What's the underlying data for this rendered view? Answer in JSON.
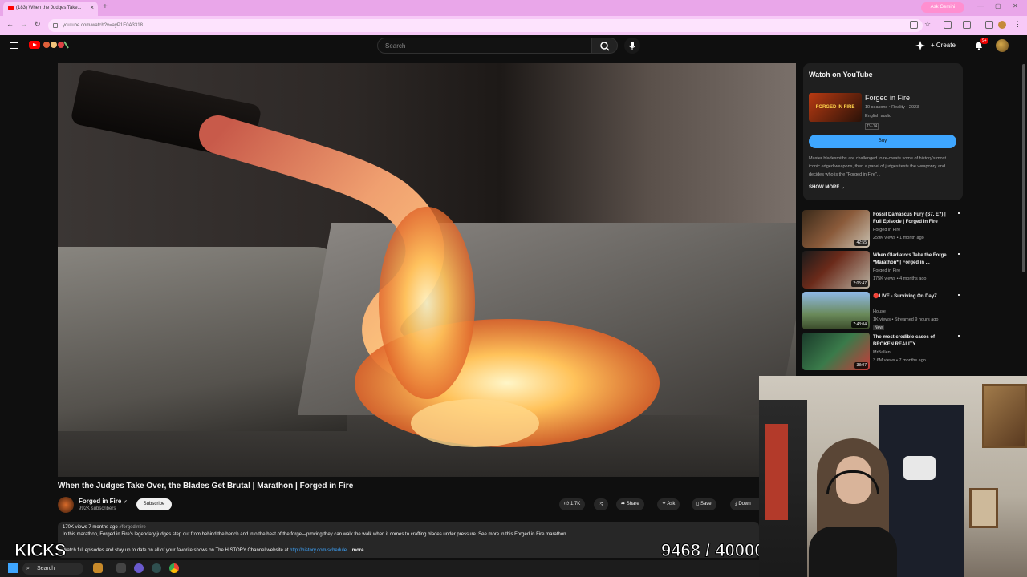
{
  "browser": {
    "tab_title": "(183) When the Judges Take...",
    "url": "youtube.com/watch?v=ayP1E0A3318",
    "gemini_label": "Ask Gemini"
  },
  "header": {
    "search_placeholder": "Search",
    "create_label": "Create",
    "notif_count": "9+"
  },
  "video": {
    "title": "When the Judges Take Over, the Blades Get Brutal | Marathon | Forged in Fire",
    "channel": "Forged in Fire",
    "subscribers": "992K subscribers",
    "subscribe_label": "Subscribe",
    "likes": "1.7K",
    "share_label": "Share",
    "ask_label": "Ask",
    "save_label": "Save",
    "download_label": "Down",
    "views_meta": "170K views  7 months ago",
    "hashtag": "#forgedinfire",
    "desc_line1": "In this marathon, Forged in Fire's legendary judges step out from behind the bench and into the heat of the forge—proving they can walk the walk when it comes to crafting blades under pressure. See more in this Forged in Fire marathon.",
    "desc_line2": "Watch full episodes and stay up to date on all of your favorite shows on The HISTORY Channel website at",
    "desc_link": "http://history.com/schedule",
    "desc_more": "...more"
  },
  "overlay": {
    "kicks": "KICKS",
    "counter": "9468 / 40000"
  },
  "watch_card": {
    "heading": "Watch on YouTube",
    "show": "Forged in Fire",
    "meta1": "10 seasons • Reality • 2023",
    "meta2": "English audio",
    "rating": "TV-14",
    "buy_label": "Buy",
    "thumb_text": "FORGED IN FIRE",
    "description": "Master bladesmiths are challenged to re-create some of history's most iconic edged weapons, then a panel of judges tests the weaponry and decides who is the \"Forged in Fire\"...",
    "show_more": "SHOW MORE"
  },
  "recommendations": [
    {
      "title": "Fossil Damascus Fury (S7, E7) | Full Episode | Forged in Fire",
      "channel": "Forged in Fire",
      "views": "259K views • 1 month ago",
      "duration": "42:55",
      "badge": ""
    },
    {
      "title": "When Gladiators Take the Forge *Marathon* | Forged in ...",
      "channel": "Forged in Fire",
      "views": "175K views • 4 months ago",
      "duration": "2:05:47",
      "badge": ""
    },
    {
      "title": "🔴LIVE - Surviving On DayZ",
      "channel": "House",
      "views": "1K views • Streamed 9 hours ago",
      "duration": "7:43:04",
      "badge": "New"
    },
    {
      "title": "The most credible cases of BROKEN REALITY...",
      "channel": "MrBallen",
      "views": "3.6M views • 7 months ago",
      "duration": "38:07",
      "badge": ""
    }
  ],
  "taskbar": {
    "search_label": "Search"
  },
  "colors": {
    "accent": "#3ea6ff",
    "brand": "#ff0000",
    "chrome": "#f7c9f7"
  }
}
